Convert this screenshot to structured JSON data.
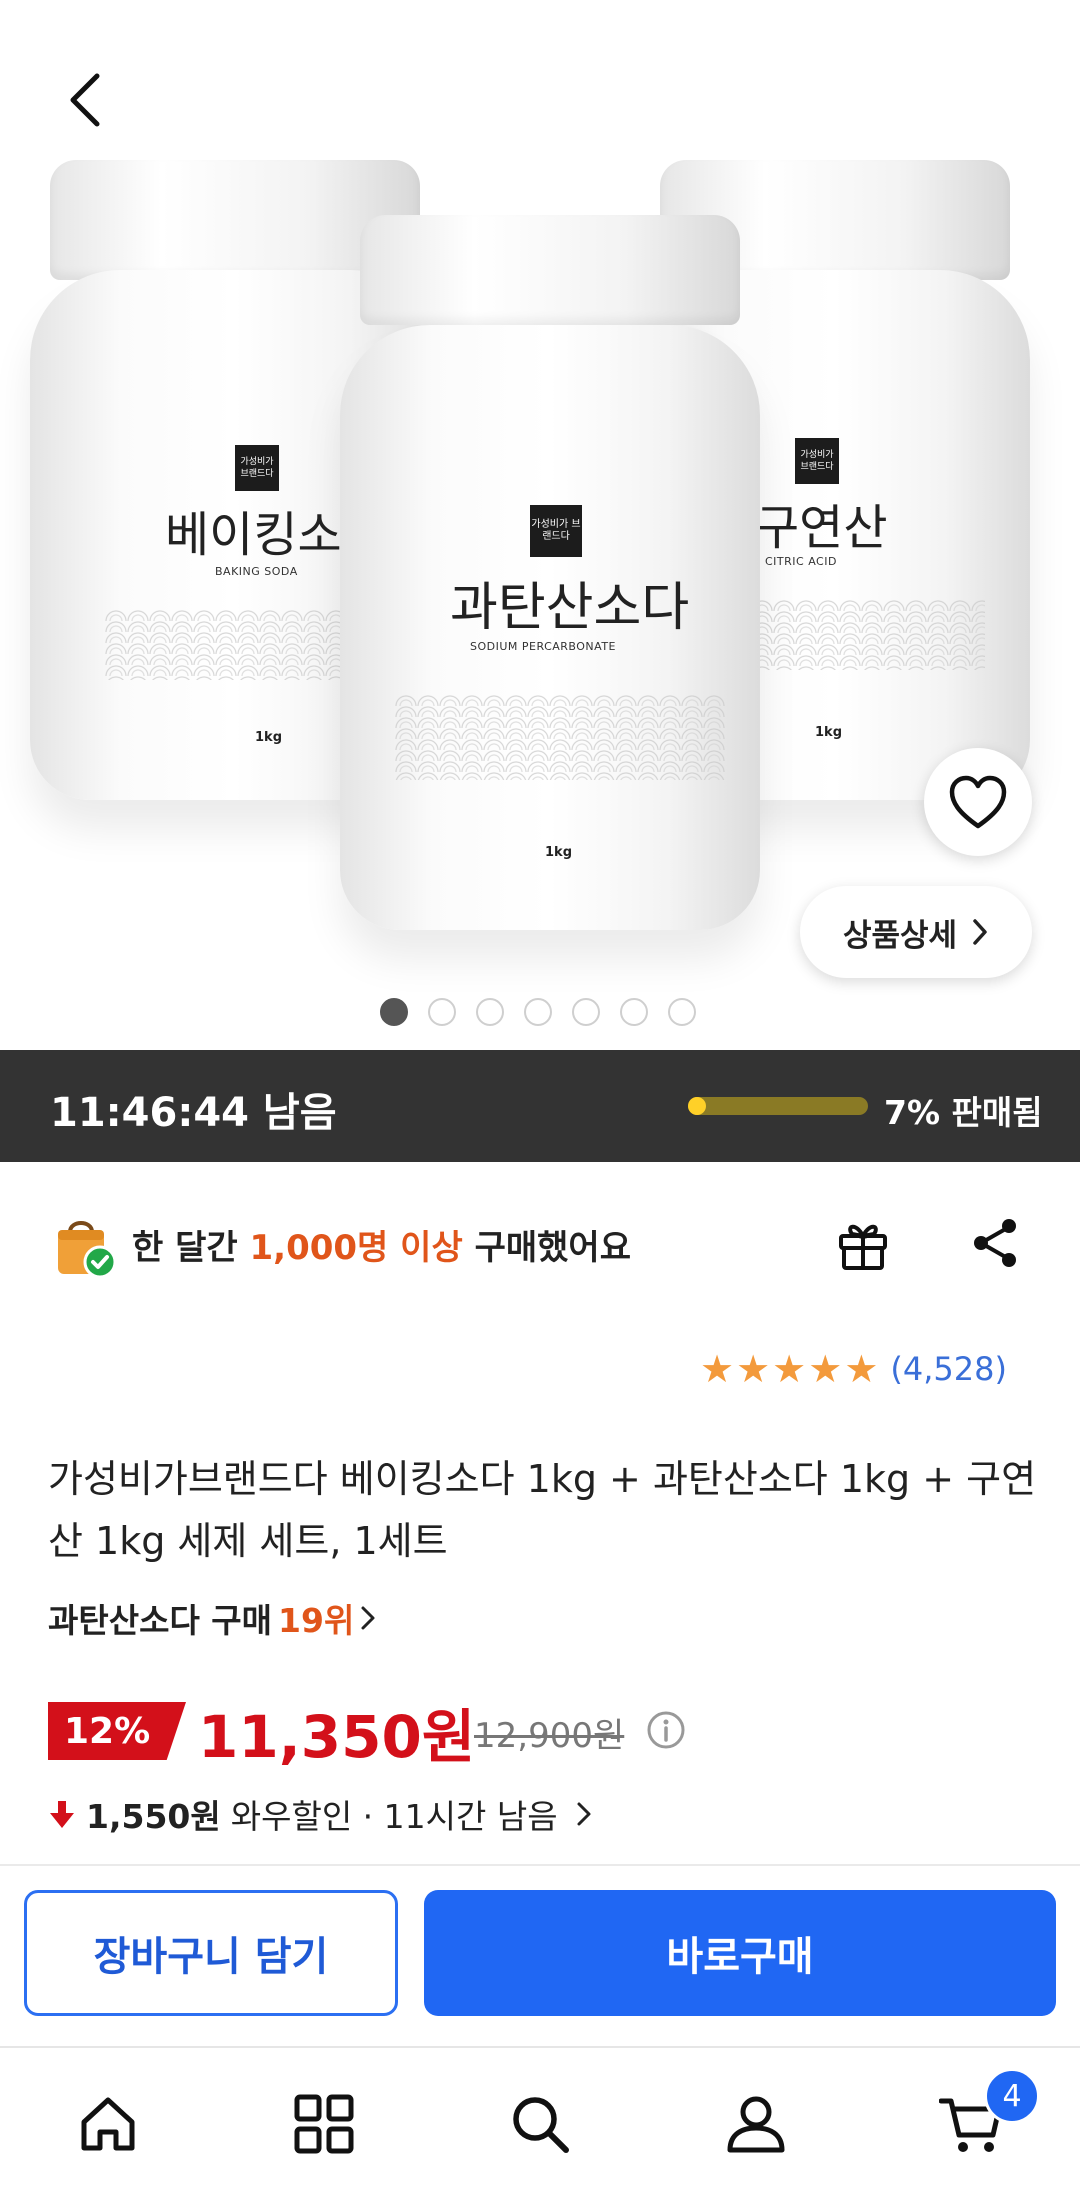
{
  "hero": {
    "jars": [
      {
        "kname": "베이킹소다",
        "ename": "BAKING SODA",
        "brand": "가성비가 브랜드다",
        "weight": "1kg"
      },
      {
        "kname": "과탄산소다",
        "ename": "SODIUM PERCARBONATE",
        "brand": "가성비가 브랜드다",
        "weight": "1kg"
      },
      {
        "kname": "구연산",
        "ename": "CITRIC ACID",
        "brand": "가성비가 브랜드다",
        "weight": "1kg"
      }
    ],
    "detail_label": "상품상세",
    "carousel_count": 7,
    "carousel_active": 1,
    "icons": {
      "back": "back-arrow-icon",
      "heart": "heart-icon",
      "chevron": "chevron-right-icon"
    }
  },
  "timer": {
    "remaining": "11:46:44 남음",
    "sold_label": "7% 판매됨",
    "sold_fraction": 0.07
  },
  "purchase": {
    "prefix": "한 달간 ",
    "highlight": "1,000명 이상",
    "suffix": " 구매했어요"
  },
  "rating": {
    "stars": 5,
    "review_count": "(4,528)"
  },
  "product": {
    "title": "가성비가브랜드다 베이킹소다 1kg + 과탄산소다 1kg + 구연산 1kg 세제 세트, 1세트",
    "rank_prefix": "과탄산소다 구매",
    "rank_value": "19위"
  },
  "price": {
    "discount": "12%",
    "sale": "11,350원",
    "original": "12,900원"
  },
  "wow": {
    "amount": "1,550원",
    "text": "와우할인 · 11시간 남음"
  },
  "cta": {
    "cart_label": "장바구니 담기",
    "buy_label": "바로구매"
  },
  "nav": {
    "items": [
      "home-icon",
      "category-grid-icon",
      "search-icon",
      "user-icon",
      "cart-icon"
    ],
    "cart_badge": "4"
  },
  "colors": {
    "accent_blue": "#2067f3",
    "sale_red": "#d3101a",
    "highlight_orange": "#e0551a",
    "star_orange": "#f39a3c",
    "timer_bg": "#333333",
    "progress_yellow": "#ffd028"
  }
}
